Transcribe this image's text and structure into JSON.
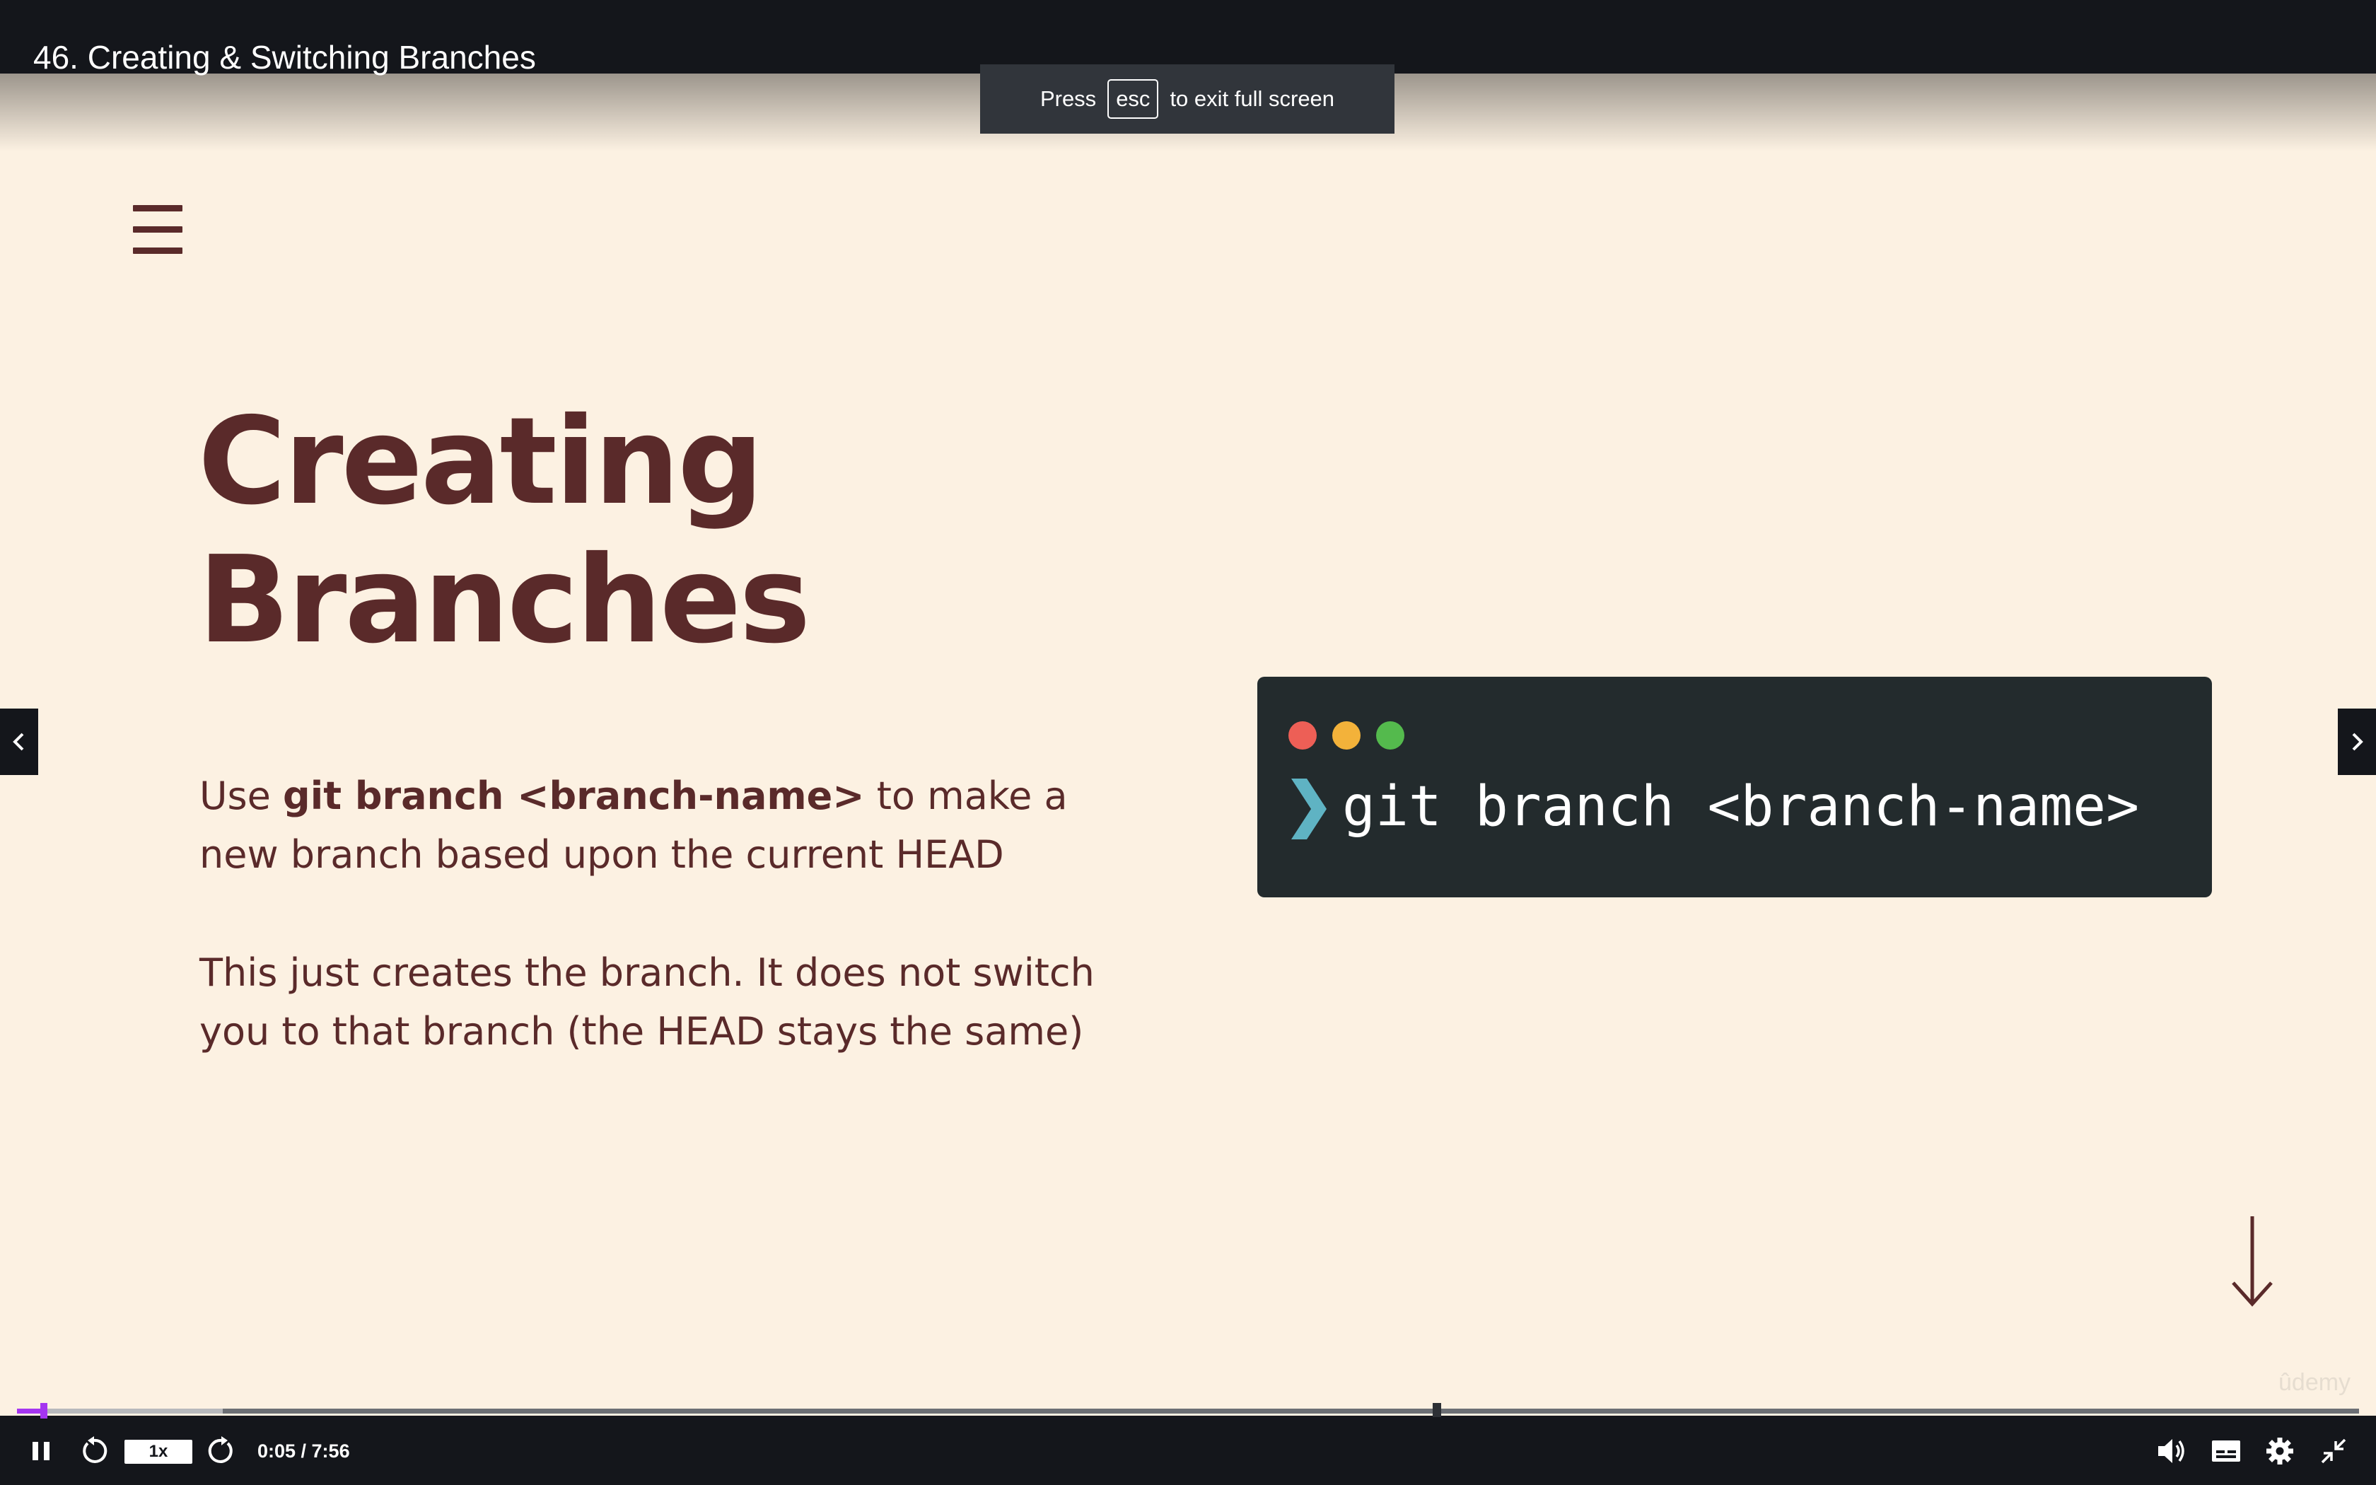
{
  "lecture": {
    "title": "46. Creating & Switching Branches"
  },
  "fullscreen_toast": {
    "press": "Press",
    "key": "esc",
    "message": "to exit full screen"
  },
  "slide": {
    "heading_line1": "Creating",
    "heading_line2": "Branches",
    "paragraph1": {
      "prefix": "Use ",
      "command": "git branch <branch-name>",
      "suffix": " to make a new branch based upon the current HEAD"
    },
    "paragraph2": "This just creates the branch.  It does not switch you to that branch (the HEAD stays the same)",
    "terminal": {
      "command": "git branch <branch-name>"
    }
  },
  "watermark": "ûdemy",
  "player": {
    "speed": "1x",
    "time": "0:05 / 7:56",
    "progress_fraction": 0.0105,
    "buffered_fraction": 0.088
  },
  "colors": {
    "slide_background": "#fcf1e2",
    "slide_text": "#5a2a2a",
    "terminal_background": "#232b2d",
    "terminal_prompt": "#5fb3c3",
    "player_bar": "#14161b",
    "progress_played": "#a435f0"
  },
  "icons": {
    "menu": "hamburger-menu-icon",
    "prev": "chevron-left-icon",
    "next": "chevron-right-icon",
    "down": "arrow-down-icon",
    "pause": "pause-icon",
    "rewind": "rewind-5-icon",
    "forward": "forward-5-icon",
    "volume": "volume-icon",
    "captions": "captions-icon",
    "settings": "gear-icon",
    "exit_fullscreen": "exit-fullscreen-icon"
  }
}
